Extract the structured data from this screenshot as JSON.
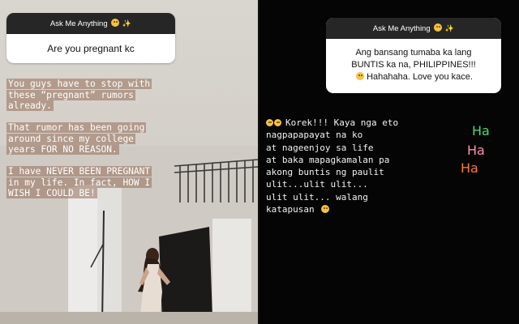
{
  "left_story": {
    "question_header": "Ask Me Anything",
    "header_emoji": "grinning-face-emoji",
    "header_sparkle": "✨",
    "question_text": "Are you pregnant kc",
    "caption_paragraphs": [
      [
        "You guys have to stop with",
        "these “pregnant” rumors",
        "already."
      ],
      [
        "That rumor has been going",
        "around since my college",
        "years FOR NO REASON."
      ],
      [
        "I have NEVER BEEN PREGNANT",
        "in my life. In fact, HOW I",
        "WISH I COULD BE!"
      ]
    ],
    "highlight_color": "#967054"
  },
  "right_story": {
    "question_header": "Ask Me Anything",
    "header_emoji": "grinning-face-emoji",
    "header_sparkle": "✨",
    "question_lines": [
      "Ang bansang tumaba ka lang",
      "BUNTIS ka na, PHILIPPINES!!!"
    ],
    "question_last_line": "Hahahaha. Love you kace.",
    "question_last_emoji": "laughing-face-emoji",
    "caption_emojis": [
      "grinning-face-emoji",
      "laughing-face-emoji"
    ],
    "caption": "Korek!!! Kaya nga eto\nnagpapapayat na ko\nat nageenjoy sa life\nat baka mapagkamalan pa\nakong buntis ng paulit\nulit...ulit ulit...\nulit ulit... walang\nkatapusan",
    "caption_end_emoji": "face-emoji",
    "ha_stickers": [
      {
        "text": "Ha",
        "color": "#4fd86a"
      },
      {
        "text": "Ha",
        "color": "#ff8fb3"
      },
      {
        "text": "Ha",
        "color": "#ff7a2e"
      }
    ]
  }
}
